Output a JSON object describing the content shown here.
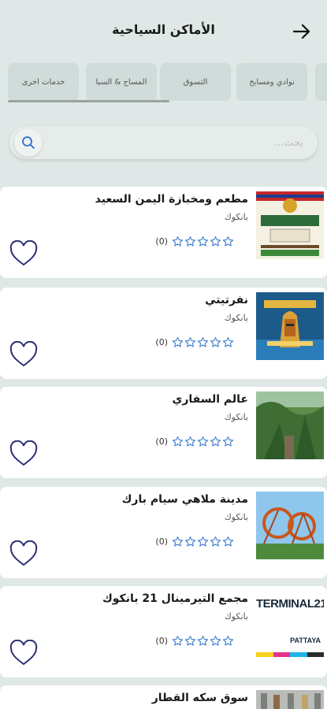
{
  "header": {
    "title": "الأماكن السياحية",
    "back_icon": "arrow-right-icon"
  },
  "tabs": [
    {
      "label": "نوادي ومسابح"
    },
    {
      "label": "التسوق"
    },
    {
      "label": "المساج & السبا"
    },
    {
      "label": "خدمات اخرى"
    }
  ],
  "search": {
    "placeholder": "بحث...",
    "icon": "search-icon"
  },
  "places": [
    {
      "name": "مطعم ومخبازة اليمن السعيد",
      "city": "بانكوك",
      "rating_count": "(0)",
      "stars": 0,
      "thumb": "yemen-restaurant-poster"
    },
    {
      "name": "نفرتيتي",
      "city": "بانكوك",
      "rating_count": "(0)",
      "stars": 0,
      "thumb": "nefertiti-poster"
    },
    {
      "name": "عالم السفاري",
      "city": "بانكوك",
      "rating_count": "(0)",
      "stars": 0,
      "thumb": "safari-forest-photo"
    },
    {
      "name": "مدينة ملاهي سيام بارك",
      "city": "بانكوك",
      "rating_count": "(0)",
      "stars": 0,
      "thumb": "roller-coaster-photo"
    },
    {
      "name": "مجمع التيرمينال 21 بانكوك",
      "city": "بانكوك",
      "rating_count": "(0)",
      "stars": 0,
      "thumb": "terminal21-logo",
      "thumb_text": "TERMINAL21",
      "thumb_subtext": "PATTAYA"
    },
    {
      "name": "سوق سكه القطار",
      "city": "",
      "rating_count": "",
      "stars": 0,
      "thumb": "train-market-photo"
    }
  ],
  "colors": {
    "background": "#dfe8e6",
    "card": "#ffffff",
    "star_outline": "#3f7fd0",
    "heart_outline": "#2a2f6e"
  }
}
